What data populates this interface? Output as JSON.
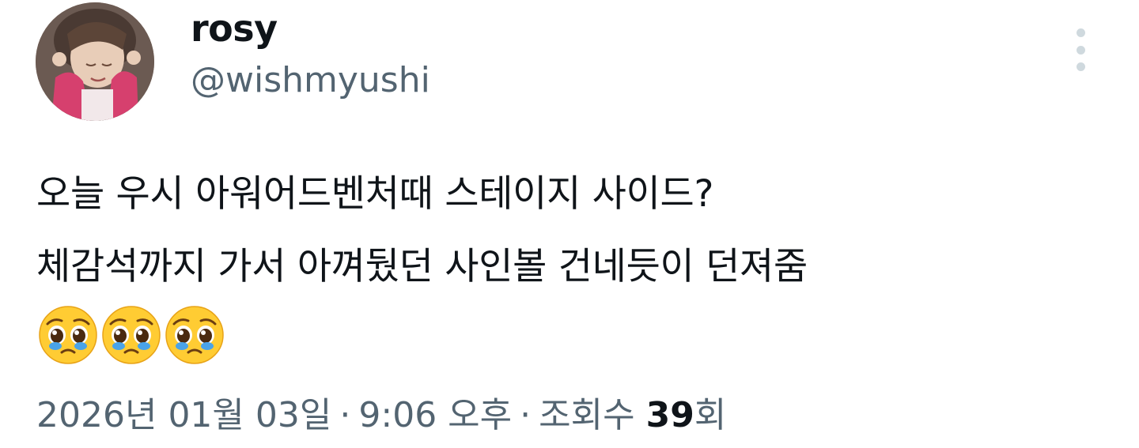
{
  "tweet": {
    "display_name": "rosy",
    "handle": "@wishmyushi",
    "text_lines": [
      "오늘 우시 아워어드벤처때 스테이지 사이드?",
      "체감석까지 가서 아껴뒀던 사인볼 건네듯이 던져줌"
    ],
    "emojis": [
      "pleading-face-emoji",
      "pleading-face-emoji",
      "pleading-face-emoji"
    ],
    "date": "2026년 01월 03일",
    "time": "9:06 오후",
    "separator": "·",
    "views_label_prefix": "조회수",
    "views_count": "39",
    "views_label_suffix": "회"
  },
  "icons": {
    "more": "more-vertical-icon"
  },
  "colors": {
    "text_primary": "#0f1419",
    "text_secondary": "#536471",
    "more_dots": "#cfd9de"
  }
}
